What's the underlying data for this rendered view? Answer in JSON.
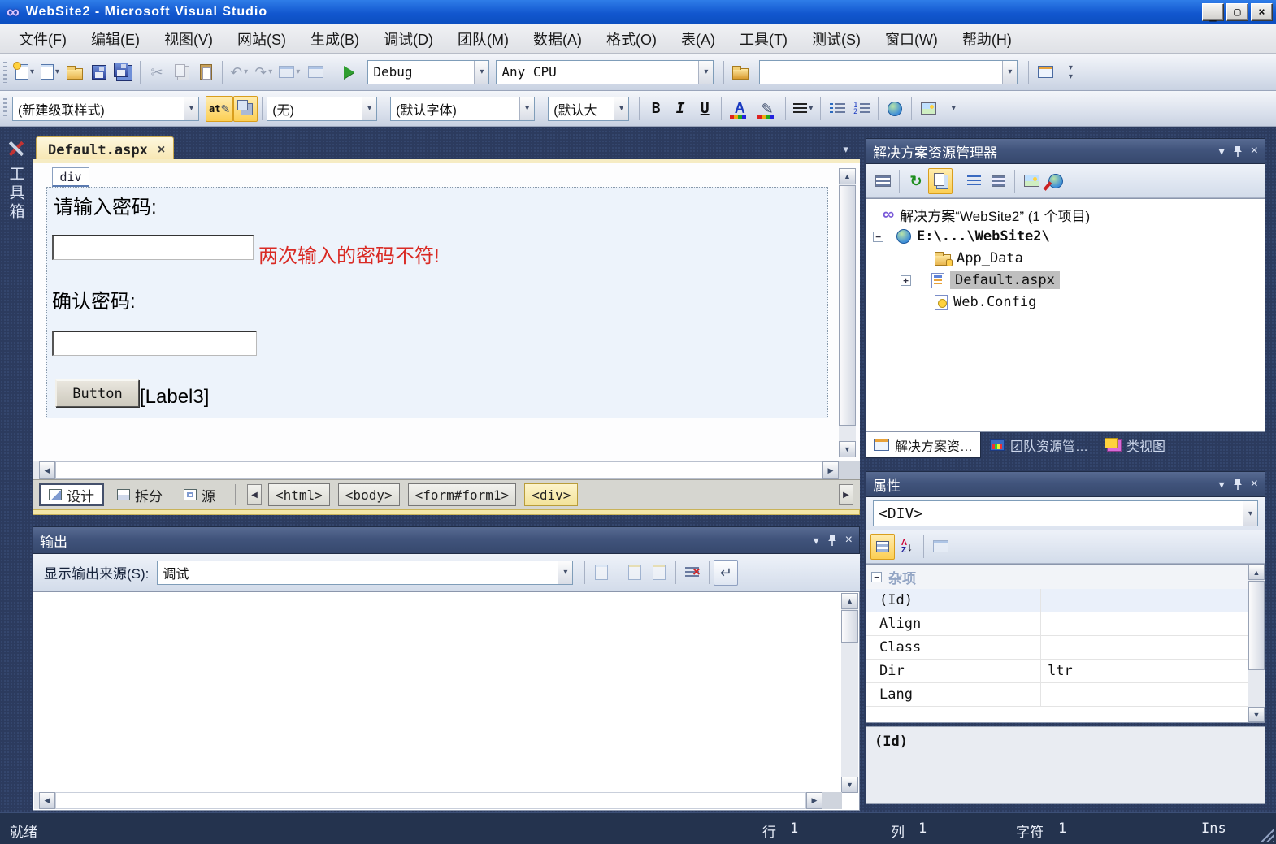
{
  "window": {
    "title": "WebSite2 - Microsoft Visual Studio"
  },
  "icons": {
    "logo": "∞",
    "minimize": "_",
    "maximize": "▢",
    "close": "×",
    "chevron_down": "▾",
    "left": "◀",
    "right": "▶",
    "up": "▲",
    "down": "▼",
    "cut": "✂",
    "undo": "↶",
    "redo": "↷",
    "refresh": "↻",
    "pencil": "✎",
    "wrap": "↵",
    "clear_x": "×",
    "expand": "+",
    "collapse": "−",
    "a": "A",
    "z": "Z",
    "down_arrow": "↓",
    "at": "at"
  },
  "menu": {
    "items": [
      "文件(F)",
      "编辑(E)",
      "视图(V)",
      "网站(S)",
      "生成(B)",
      "调试(D)",
      "团队(M)",
      "数据(A)",
      "格式(O)",
      "表(A)",
      "工具(T)",
      "测试(S)",
      "窗口(W)",
      "帮助(H)"
    ]
  },
  "toolbar_standard": {
    "debug": "Debug",
    "platform": "Any CPU",
    "search": ""
  },
  "toolbar_format": {
    "style": "(新建级联样式)",
    "target": "(无)",
    "font": "(默认字体)",
    "size": "(默认大",
    "bold": "B",
    "italic": "I",
    "underline": "U"
  },
  "toolbox": {
    "label": "工具箱"
  },
  "document": {
    "tab": "Default.aspx",
    "tag": "div",
    "prompt_password": "请输入密码:",
    "error": "两次输入的密码不符!",
    "prompt_confirm": "确认密码:",
    "button": "Button",
    "label3": "[Label3]"
  },
  "view_tabs": {
    "design": "设计",
    "split": "拆分",
    "source": "源",
    "breadcrumbs": [
      "<html>",
      "<body>",
      "<form#form1>",
      "<div>"
    ]
  },
  "output": {
    "title": "输出",
    "source_label": "显示输出来源(S):",
    "source": "调试"
  },
  "solution_explorer": {
    "title": "解决方案资源管理器",
    "solution": "解决方案“WebSite2” (1 个项目)",
    "project": "E:\\...\\WebSite2\\",
    "children": [
      "App_Data",
      "Default.aspx",
      "Web.Config"
    ],
    "tabs": [
      "解决方案资…",
      "团队资源管…",
      "类视图"
    ]
  },
  "properties": {
    "title": "属性",
    "object": "<DIV>",
    "category": "杂项",
    "rows": [
      {
        "name": "(Id)",
        "value": ""
      },
      {
        "name": "Align",
        "value": ""
      },
      {
        "name": "Class",
        "value": ""
      },
      {
        "name": "Dir",
        "value": "ltr"
      },
      {
        "name": "Lang",
        "value": ""
      }
    ],
    "description": "(Id)"
  },
  "status": {
    "ready": "就绪",
    "line_label": "行",
    "line": "1",
    "col_label": "列",
    "col": "1",
    "char_label": "字符",
    "char": "1",
    "ins": "Ins"
  }
}
